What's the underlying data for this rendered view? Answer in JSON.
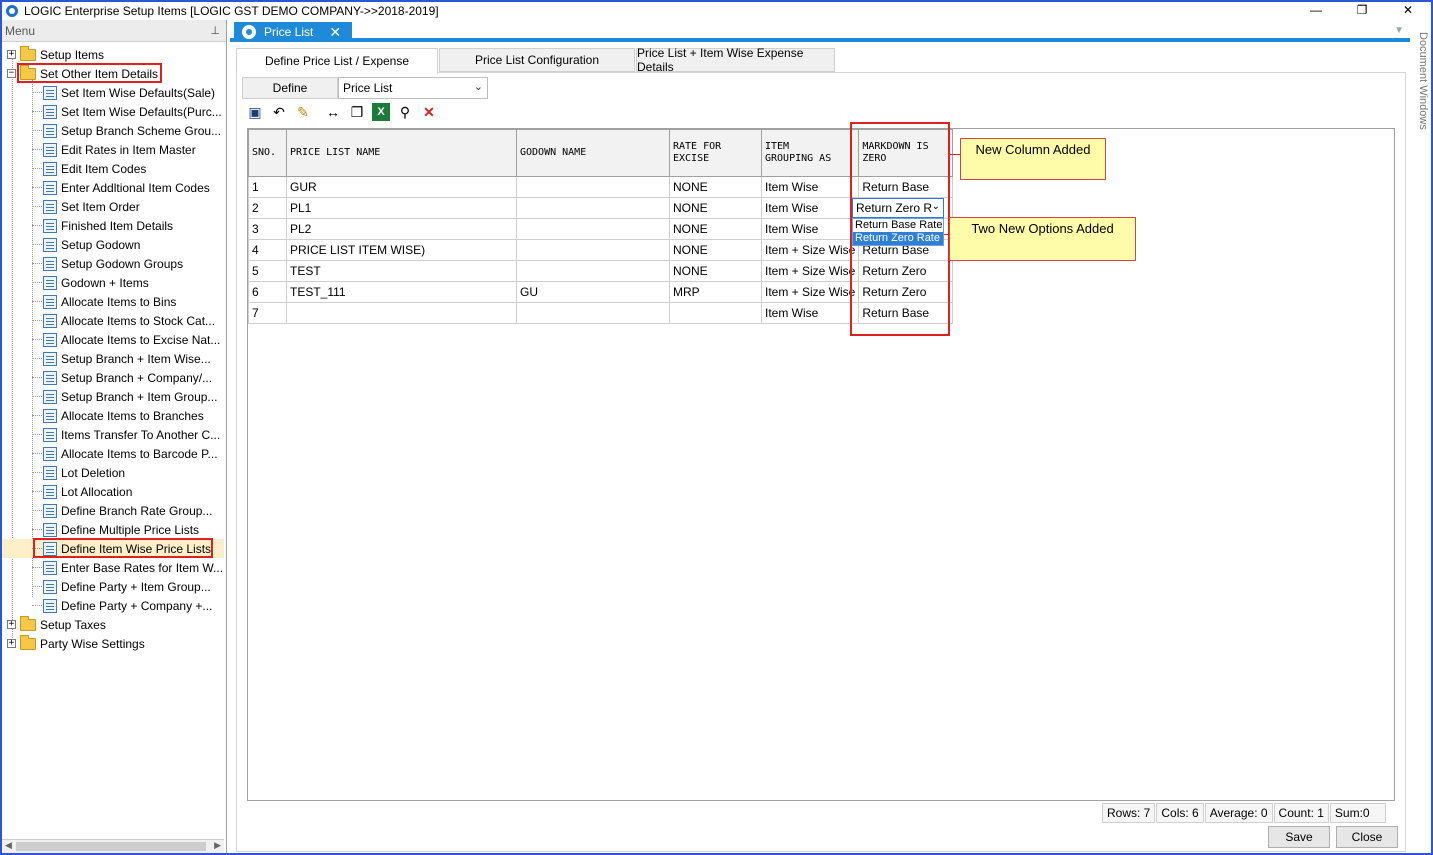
{
  "window": {
    "title": "LOGIC Enterprise Setup Items  [LOGIC GST DEMO COMPANY->>2018-2019]",
    "minimize": "—",
    "restore": "❐",
    "close": "✕"
  },
  "menu": {
    "title": "Menu",
    "pin": "⊥",
    "items": [
      {
        "label": "Setup Items",
        "level": 0,
        "type": "folder",
        "expander": "+"
      },
      {
        "label": "Set Other Item Details",
        "level": 0,
        "type": "folder",
        "expander": "−"
      },
      {
        "label": "Set Item Wise Defaults(Sale)",
        "level": 1,
        "type": "doc"
      },
      {
        "label": "Set Item Wise Defaults(Purc...",
        "level": 1,
        "type": "doc"
      },
      {
        "label": "Setup Branch Scheme Grou...",
        "level": 1,
        "type": "doc"
      },
      {
        "label": "Edit Rates in Item Master",
        "level": 1,
        "type": "doc"
      },
      {
        "label": "Edit Item Codes",
        "level": 1,
        "type": "doc"
      },
      {
        "label": "Enter Addltional Item Codes",
        "level": 1,
        "type": "doc"
      },
      {
        "label": "Set Item Order",
        "level": 1,
        "type": "doc"
      },
      {
        "label": "Finished Item Details",
        "level": 1,
        "type": "doc"
      },
      {
        "label": "Setup Godown",
        "level": 1,
        "type": "doc"
      },
      {
        "label": "Setup Godown Groups",
        "level": 1,
        "type": "doc"
      },
      {
        "label": "Godown + Items",
        "level": 1,
        "type": "doc"
      },
      {
        "label": "Allocate Items to Bins",
        "level": 1,
        "type": "doc"
      },
      {
        "label": "Allocate Items to Stock Cat...",
        "level": 1,
        "type": "doc"
      },
      {
        "label": "Allocate Items to Excise Nat...",
        "level": 1,
        "type": "doc"
      },
      {
        "label": "Setup Branch + Item Wise...",
        "level": 1,
        "type": "doc"
      },
      {
        "label": "Setup Branch + Company/...",
        "level": 1,
        "type": "doc"
      },
      {
        "label": "Setup Branch + Item Group...",
        "level": 1,
        "type": "doc"
      },
      {
        "label": "Allocate Items to Branches",
        "level": 1,
        "type": "doc"
      },
      {
        "label": "Items Transfer To Another C...",
        "level": 1,
        "type": "doc"
      },
      {
        "label": "Allocate Items to Barcode P...",
        "level": 1,
        "type": "doc"
      },
      {
        "label": "Lot Deletion",
        "level": 1,
        "type": "doc"
      },
      {
        "label": "Lot Allocation",
        "level": 1,
        "type": "doc"
      },
      {
        "label": "Define Branch Rate Group...",
        "level": 1,
        "type": "doc"
      },
      {
        "label": "Define Multiple Price Lists",
        "level": 1,
        "type": "doc"
      },
      {
        "label": "Define Item Wise Price Lists",
        "level": 1,
        "type": "doc"
      },
      {
        "label": "Enter Base Rates for Item W...",
        "level": 1,
        "type": "doc"
      },
      {
        "label": "Define Party + Item Group...",
        "level": 1,
        "type": "doc"
      },
      {
        "label": "Define Party + Company +...",
        "level": 1,
        "type": "doc"
      },
      {
        "label": "Setup Taxes",
        "level": 0,
        "type": "folder",
        "expander": "+"
      },
      {
        "label": "Party Wise Settings",
        "level": 0,
        "type": "folder",
        "expander": "+"
      }
    ]
  },
  "doc_tab": {
    "label": "Price List",
    "close": "✕"
  },
  "side_panel_label": "Document Windows",
  "sub_tabs": [
    "Define Price List / Expense",
    "Price List Configuration",
    "Price List + Item Wise Expense Details"
  ],
  "define": {
    "tab_label": "Define",
    "combo_value": "Price List"
  },
  "toolbar": {
    "icons": [
      "save-icon",
      "undo-icon",
      "edit-icon",
      "column-width-icon",
      "copy-icon",
      "excel-icon",
      "find-icon",
      "delete-icon"
    ],
    "glyphs": [
      "▣",
      "↶",
      "✎",
      "↔",
      "❐",
      "X",
      "⚲",
      "✕"
    ]
  },
  "grid": {
    "headers": [
      [
        "SNO."
      ],
      [
        "PRICE LIST NAME"
      ],
      [
        "GODOWN NAME"
      ],
      [
        "RATE FOR",
        "EXCISE"
      ],
      [
        "ITEM",
        "GROUPING AS"
      ],
      [
        "MARKDOWN IS",
        "ZERO"
      ]
    ],
    "rows": [
      [
        "1",
        "GUR",
        "",
        "NONE",
        "Item Wise",
        "Return Base"
      ],
      [
        "2",
        "PL1",
        "",
        "NONE",
        "Item Wise",
        ""
      ],
      [
        "3",
        "PL2",
        "",
        "NONE",
        "Item Wise",
        "Return Base"
      ],
      [
        "4",
        "PRICE LIST ITEM WISE)",
        "",
        "NONE",
        "Item + Size Wise",
        "Return Base"
      ],
      [
        "5",
        "TEST",
        "",
        "NONE",
        "Item + Size Wise",
        "Return Zero"
      ],
      [
        "6",
        "TEST_111",
        "GU",
        "MRP",
        "Item + Size Wise",
        "Return Zero"
      ],
      [
        "7",
        "",
        "",
        "",
        "Item Wise",
        "Return Base"
      ]
    ],
    "editing_cell_value": "Return Zero R",
    "dropdown_options": [
      "Return Base Rate",
      "Return Zero Rate"
    ],
    "dropdown_selected_index": 1
  },
  "callouts": {
    "new_column": "New Column Added",
    "new_options": "Two New Options Added"
  },
  "status": {
    "rows": "Rows: 7",
    "cols": "Cols: 6",
    "average": "Average: 0",
    "count": "Count: 1",
    "sum": "Sum:0"
  },
  "buttons": {
    "save": "Save",
    "close": "Close"
  }
}
